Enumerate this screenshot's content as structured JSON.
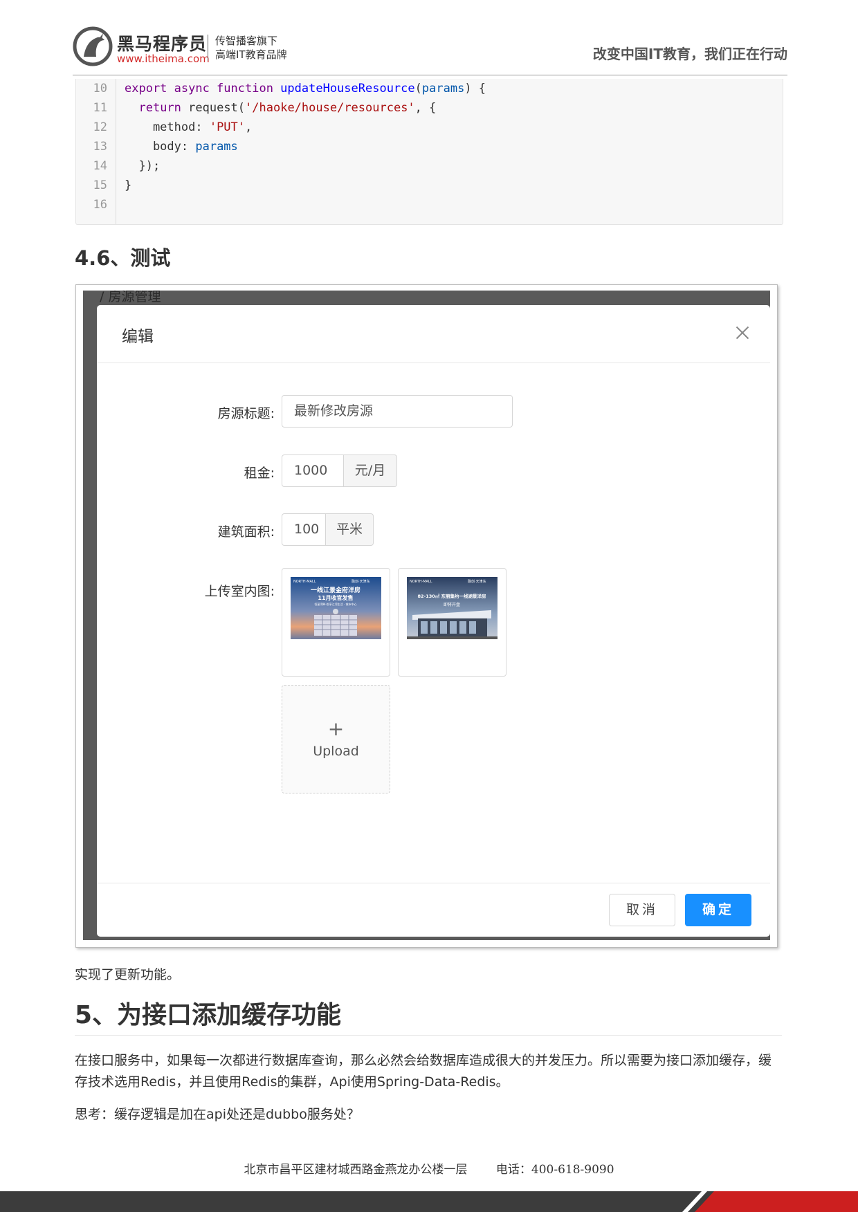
{
  "header": {
    "brand_name": "黑马程序员",
    "brand_url": "www.itheima.com",
    "tagline_1": "传智播客旗下",
    "tagline_2": "高端IT教育品牌",
    "slogan": "改变中国IT教育，我们正在行动"
  },
  "code": {
    "line_numbers": [
      "10",
      "11",
      "12",
      "13",
      "14",
      "15",
      "16"
    ],
    "lines": [
      [
        {
          "t": "export async function ",
          "c": "kw"
        },
        {
          "t": "updateHouseResource",
          "c": "fn"
        },
        {
          "t": "(",
          "c": ""
        },
        {
          "t": "params",
          "c": "var"
        },
        {
          "t": ") {",
          "c": ""
        }
      ],
      [
        {
          "t": "  ",
          "c": ""
        },
        {
          "t": "return",
          "c": "kw"
        },
        {
          "t": " request(",
          "c": ""
        },
        {
          "t": "'/haoke/house/resources'",
          "c": "str"
        },
        {
          "t": ", {",
          "c": ""
        }
      ],
      [
        {
          "t": "    method: ",
          "c": ""
        },
        {
          "t": "'PUT'",
          "c": "str"
        },
        {
          "t": ",",
          "c": ""
        }
      ],
      [
        {
          "t": "    body: ",
          "c": ""
        },
        {
          "t": "params",
          "c": "var"
        }
      ],
      [
        {
          "t": "  });",
          "c": ""
        }
      ],
      [
        {
          "t": "}",
          "c": ""
        }
      ],
      []
    ]
  },
  "section_46": {
    "heading": "4.6、测试"
  },
  "screenshot": {
    "bg_peek_text": "/ 房源管理",
    "modal_title": "编辑",
    "fields": {
      "title_label": "房源标题:",
      "title_value": "最新修改房源",
      "rent_label": "租金:",
      "rent_value": "1000",
      "rent_unit": "元/月",
      "area_label": "建筑面积:",
      "area_value": "100",
      "area_unit": "平米",
      "images_label": "上传室内图:"
    },
    "thumb1": {
      "top_left": "NORTH·MALL",
      "top_right": "融创·天津东",
      "line1": "一线江景金府洋房",
      "line2": "11月收官发售",
      "line3": "恒丽湾畔·悦享江湾生活 · 城市中心"
    },
    "thumb2": {
      "top_left": "NORTH·MALL",
      "top_right": "融创·天津东",
      "line1": "82-130㎡ 东丽集约一线湖景洋房",
      "line2": "即将开盘"
    },
    "upload_plus": "+",
    "upload_text": "Upload",
    "cancel_label": "取消",
    "ok_label": "确定"
  },
  "after_shot_text": "实现了更新功能。",
  "section_5": {
    "heading": "5、为接口添加缓存功能",
    "paragraph": "在接口服务中，如果每一次都进行数据库查询，那么必然会给数据库造成很大的并发压力。所以需要为接口添加缓存，缓存技术选用Redis，并且使用Redis的集群，Api使用Spring-Data-Redis。",
    "question": "思考：缓存逻辑是加在api处还是dubbo服务处？"
  },
  "footer": {
    "address": "北京市昌平区建材城西路金燕龙办公楼一层",
    "phone": "电话：400-618-9090"
  },
  "colors": {
    "primary_button": "#1890ff",
    "brand_red": "#d32b2b",
    "footer_bar": "#3c3c3c",
    "footer_red": "#cc1f1f"
  }
}
